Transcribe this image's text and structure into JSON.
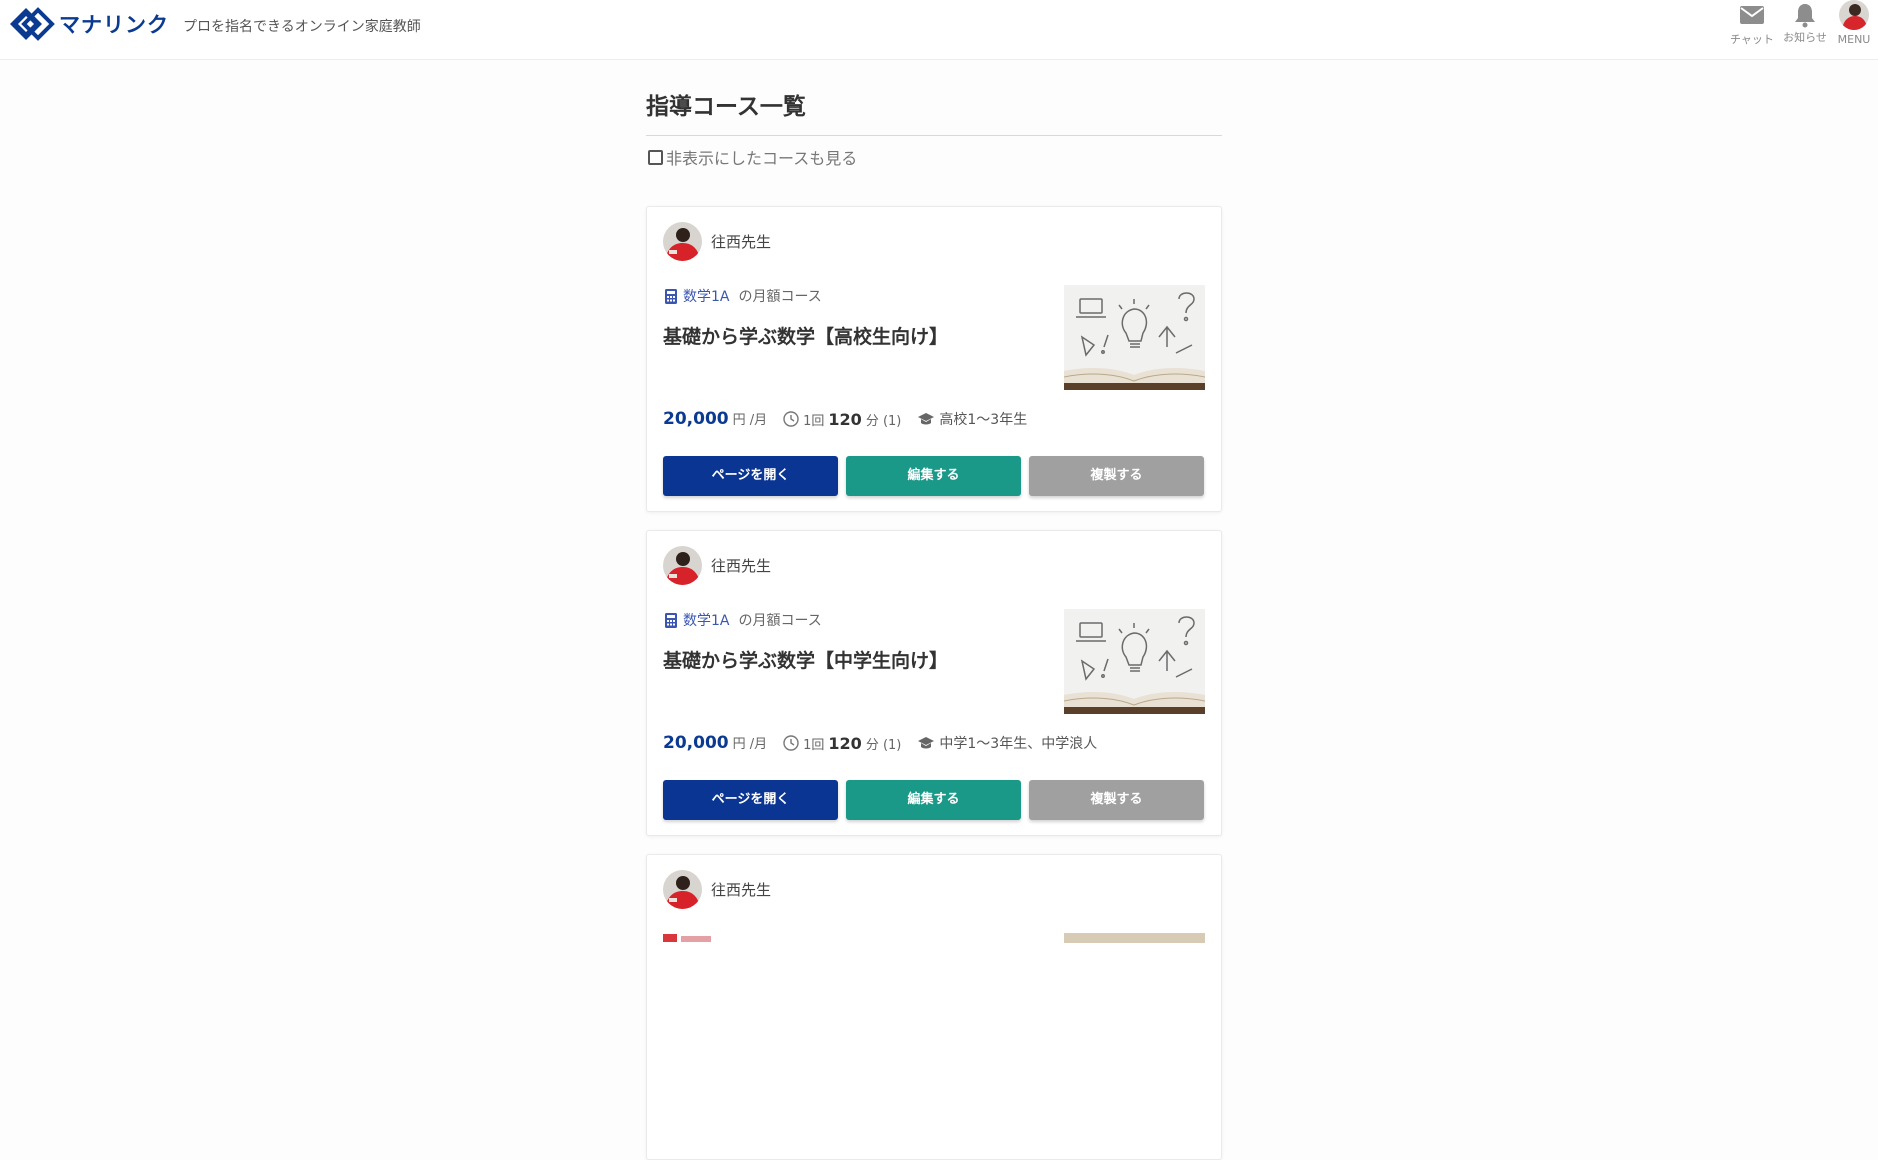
{
  "header": {
    "logo_text": "マナリンク",
    "tagline": "プロを指名できるオンライン家庭教師",
    "chat_label": "チャット",
    "news_label": "お知らせ",
    "menu_label": "MENU"
  },
  "page": {
    "title": "指導コース一覧",
    "show_hidden_label": "非表示にしたコースも見る"
  },
  "colors": {
    "brand": "#0b3a91",
    "edit": "#1a9888",
    "copy": "#a0a0a0"
  },
  "courses": [
    {
      "teacher": "往西先生",
      "subject": "数学1A",
      "plan": "の月額コース",
      "title": "基礎から学ぶ数学【高校生向け】",
      "price": "20,000",
      "price_unit": "円 /月",
      "per_lesson": "1回",
      "minutes": "120",
      "minutes_unit": "分 (1)",
      "grade": "高校1～3年生",
      "btn_open": "ページを開く",
      "btn_edit": "編集する",
      "btn_copy": "複製する"
    },
    {
      "teacher": "往西先生",
      "subject": "数学1A",
      "plan": "の月額コース",
      "title": "基礎から学ぶ数学【中学生向け】",
      "price": "20,000",
      "price_unit": "円 /月",
      "per_lesson": "1回",
      "minutes": "120",
      "minutes_unit": "分 (1)",
      "grade": "中学1～3年生、中学浪人",
      "btn_open": "ページを開く",
      "btn_edit": "編集する",
      "btn_copy": "複製する"
    },
    {
      "teacher": "往西先生"
    }
  ]
}
